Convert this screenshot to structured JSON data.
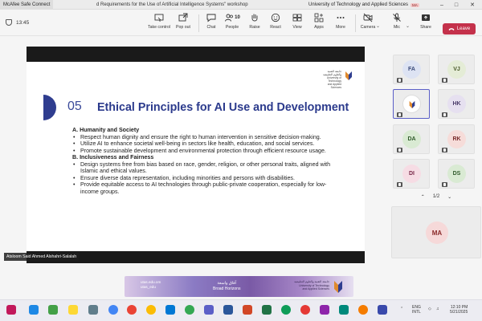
{
  "titlebar": {
    "app_tab": "McAfee Safe Connect",
    "title": "d Requirements for the Use of Artificial Intelligence Systems\" workshop",
    "org": "University of Technology and Applied Sciences",
    "user_initials": "MA"
  },
  "toolbar": {
    "timer": "13:45",
    "buttons": [
      {
        "label": "Take control",
        "icon": "take-control-icon"
      },
      {
        "label": "Pop out",
        "icon": "pop-out-icon"
      },
      {
        "label": "Chat",
        "icon": "chat-icon"
      },
      {
        "label": "People",
        "icon": "people-icon",
        "count": "10"
      },
      {
        "label": "Raise",
        "icon": "raise-hand-icon"
      },
      {
        "label": "React",
        "icon": "react-icon"
      },
      {
        "label": "View",
        "icon": "view-icon"
      },
      {
        "label": "Apps",
        "icon": "apps-icon"
      },
      {
        "label": "More",
        "icon": "more-icon"
      },
      {
        "label": "Camera",
        "icon": "camera-off-icon"
      },
      {
        "label": "Mic",
        "icon": "mic-off-icon"
      },
      {
        "label": "Share",
        "icon": "share-icon"
      }
    ],
    "leave_label": "Leave",
    "accent": "#c4314b"
  },
  "slide": {
    "number": "05",
    "title": "Ethical Principles for AI Use and Development",
    "logo_text": "جامعة التقنية والعلوم التطبيقية University of Technology and Applied Sciences",
    "sections": [
      {
        "heading": "A. Humanity and Society",
        "bullets": [
          "Respect human dignity and ensure the right to human intervention in sensitive decision-making.",
          "Utilize AI to enhance societal well-being in sectors like health, education, and social services.",
          "Promote sustainable development and environmental protection through efficient resource usage."
        ]
      },
      {
        "heading": "B. Inclusiveness and Fairness",
        "bullets": [
          "Design systems free from bias based on race, gender, religion, or other personal traits, aligned with Islamic and ethical values.",
          "Ensure diverse data representation, including minorities and persons with disabilities.",
          "Provide equitable access to AI technologies through public-private cooperation, especially for low-income groups."
        ]
      }
    ],
    "presenter": "Atsloom Said Ahmed Alshahri-Salalah",
    "title_color": "#2b3a8c"
  },
  "participants": {
    "tiles": [
      {
        "initials": "FA",
        "bg": "#dde3f3",
        "fg": "#3a4a7a"
      },
      {
        "initials": "VJ",
        "bg": "#e4ecd6",
        "fg": "#4a5a2a"
      },
      {
        "initials": "",
        "bg": "#ffffff",
        "fg": "#333",
        "logo": true
      },
      {
        "initials": "HK",
        "bg": "#e6e0f0",
        "fg": "#4a3a6a"
      },
      {
        "initials": "DA",
        "bg": "#d9ead3",
        "fg": "#2f5a2a"
      },
      {
        "initials": "RK",
        "bg": "#f6dcd9",
        "fg": "#7a2a2a"
      },
      {
        "initials": "DI",
        "bg": "#f6dce4",
        "fg": "#7a2a4a"
      },
      {
        "initials": "DS",
        "bg": "#d9ead3",
        "fg": "#2f5a2a"
      }
    ],
    "pager": "1/2",
    "featured": {
      "initials": "MA"
    }
  },
  "banner": {
    "left_line1": "utas.edu.om",
    "left_line2": "utas_edu",
    "mid_ar": "آفاق واسعة",
    "mid_en": "Broad Horizons",
    "right_text": "جامعة التقنية والعلوم التطبيقية University of Technology and Applied Sciences"
  },
  "taskbar": {
    "lang_line1": "ENG",
    "lang_line2": "INTL",
    "time": "12:10 PM",
    "date": "5/21/2025"
  }
}
